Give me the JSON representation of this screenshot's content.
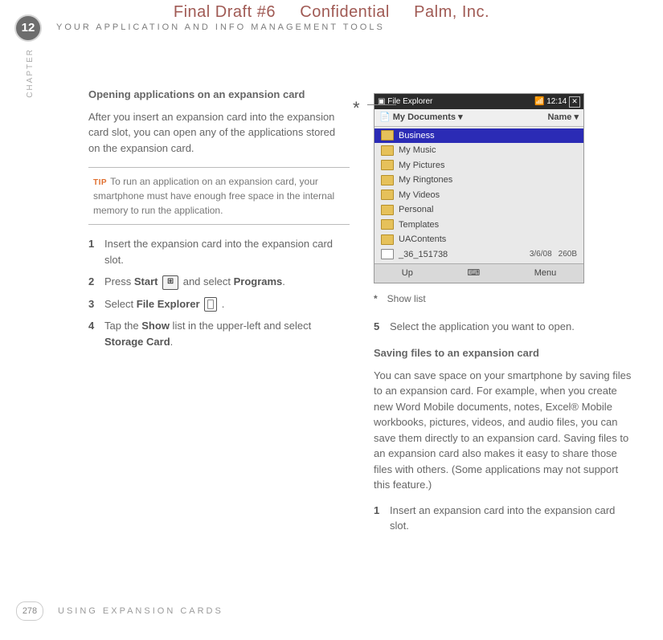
{
  "banner": {
    "draft": "Final Draft #6",
    "conf": "Confidential",
    "company": "Palm, Inc."
  },
  "chapter_number": "12",
  "running_head": "YOUR APPLICATION AND INFO MANAGEMENT TOOLS",
  "chapter_tab": "CHAPTER",
  "left": {
    "subhead": "Opening applications on an expansion card",
    "intro": "After you insert an expansion card into the expansion card slot, you can open any of the applications stored on the expansion card.",
    "tip_label": "TIP",
    "tip": "To run an application on an expansion card, your smartphone must have enough free space in the internal memory to run the application.",
    "steps": [
      {
        "n": "1",
        "t": "Insert the expansion card into the expansion card slot."
      },
      {
        "n": "2",
        "pre": "Press ",
        "b1": "Start",
        "mid": " and select ",
        "b2": "Programs",
        "post": "."
      },
      {
        "n": "3",
        "pre": "Select ",
        "b1": "File Explorer",
        "post": " ."
      },
      {
        "n": "4",
        "pre": "Tap the ",
        "b1": "Show",
        "mid": " list in the upper-left and select ",
        "b2": "Storage Card",
        "post": "."
      }
    ]
  },
  "device": {
    "title": "File Explorer",
    "clock": "12:14",
    "hdr_left": "My Documents",
    "hdr_right": "Name",
    "rows": [
      {
        "label": "Business",
        "sel": true
      },
      {
        "label": "My Music"
      },
      {
        "label": "My Pictures"
      },
      {
        "label": "My Ringtones"
      },
      {
        "label": "My Videos"
      },
      {
        "label": "Personal"
      },
      {
        "label": "Templates"
      },
      {
        "label": "UAContents"
      },
      {
        "label": "_36_151738",
        "file": true,
        "date": "3/6/08",
        "size": "260B"
      }
    ],
    "foot_left": "Up",
    "foot_right": "Menu"
  },
  "legend": {
    "mark": "*",
    "text": "Show list"
  },
  "right": {
    "step5n": "5",
    "step5t": "Select the application you want to open.",
    "subhead2": "Saving files to an expansion card",
    "para": "You can save space on your smartphone by saving files to an expansion card. For example, when you create new Word Mobile documents, notes, Excel® Mobile workbooks, pictures, videos, and audio files, you can save them directly to an expansion card. Saving files to an expansion card also makes it easy to share those files with others. (Some applications may not support this feature.)",
    "step1n": "1",
    "step1t": "Insert an expansion card into the expansion card slot."
  },
  "footer": {
    "page": "278",
    "text": "USING EXPANSION CARDS"
  }
}
